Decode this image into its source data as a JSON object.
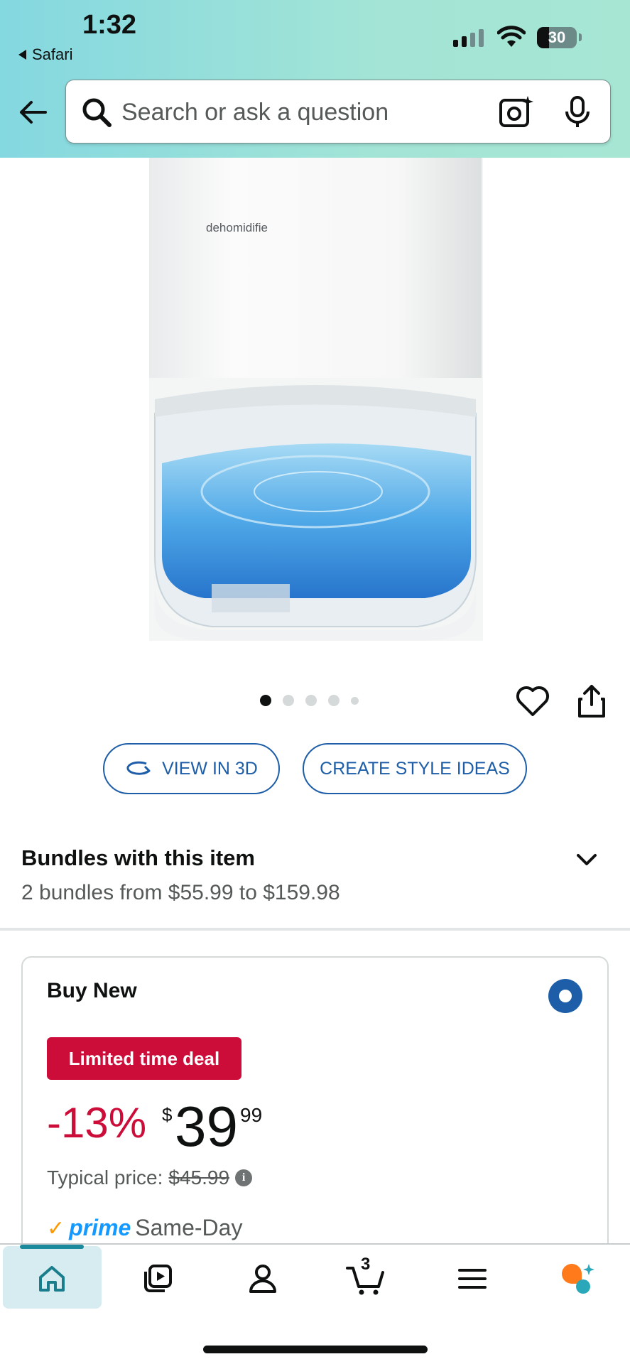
{
  "status_bar": {
    "time": "1:32",
    "back_app": "Safari",
    "battery": "30",
    "battery_level": 0.3
  },
  "search": {
    "placeholder": "Search or ask a question"
  },
  "product_image": {
    "brand_text": "dehomidifie"
  },
  "carousel": {
    "dot_count": 5,
    "active_index": 0
  },
  "actions": {
    "view_3d": "VIEW IN 3D",
    "style_ideas": "CREATE STYLE IDEAS"
  },
  "bundles": {
    "title": "Bundles with this item",
    "subtitle": "2 bundles from $55.99 to $159.98"
  },
  "buy_box": {
    "title": "Buy New",
    "deal_badge": "Limited time deal",
    "discount": "-13%",
    "currency": "$",
    "price_whole": "39",
    "price_fraction": "99",
    "typical_label": "Typical price:",
    "typical_price": "$45.99",
    "info_glyph": "i",
    "prime_check": "✓",
    "prime_word": "prime",
    "delivery": "Same-Day"
  },
  "bottom_nav": {
    "cart_count": "3",
    "items": [
      "home-icon",
      "video-icon",
      "account-icon",
      "cart-icon",
      "menu-icon",
      "rufus-icon"
    ]
  },
  "colors": {
    "accent_blue": "#1e5ea8",
    "deal_red": "#cc0c39",
    "prime_blue": "#1399ff",
    "prime_orange": "#ff9900",
    "header_teal": "#a3e4d6"
  }
}
